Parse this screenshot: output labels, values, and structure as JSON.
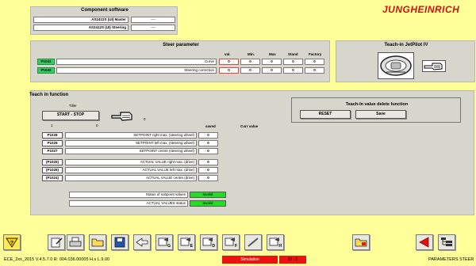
{
  "brand": "JUNGHEINRICH",
  "component_software": {
    "title": "Component software",
    "rows": [
      {
        "name": "AS2412S (UI) Master",
        "value": "----"
      },
      {
        "name": "AS2412S (UI) Steering",
        "value": "----"
      }
    ]
  },
  "steer_parameter": {
    "title": "Steer parameter",
    "headers": {
      "val": "val.",
      "min": "Min.",
      "max": "Max",
      "stand": "Stand",
      "factory": "Factory"
    },
    "rows": [
      {
        "code": "P1041",
        "name": "Curve",
        "val": "0",
        "min": "0",
        "max": "0",
        "stand": "0",
        "factory": "0"
      },
      {
        "code": "P1043",
        "name": "Steering correction",
        "val": "0",
        "min": "0",
        "max": "0",
        "stand": "0",
        "factory": "0"
      }
    ]
  },
  "teach_jetpilot": {
    "title": "Teach-in JetPilot IV"
  },
  "teach_function": {
    "title": "Teach in function",
    "tiller_label": "Tiller",
    "start_stop_label": "START - STOP",
    "start_stop_value": "0",
    "one_label": "1",
    "zero_label": "0",
    "col_saved": "saved",
    "col_curr": "Curr value",
    "setpoints": [
      {
        "code": "P1028",
        "name": "SETPOINT right max. (steering wheel)",
        "value": "0"
      },
      {
        "code": "P1029",
        "name": "SETPOINT left max. (steering wheel)",
        "value": "0"
      },
      {
        "code": "P1027",
        "name": "SETPOINT centre (steering wheel)",
        "value": "0"
      }
    ],
    "actuals": [
      {
        "code": "(P1025)",
        "name": "ACTUAL VALUE right max. (drive)",
        "value": "0"
      },
      {
        "code": "(P1026)",
        "name": "ACTUAL VALUE left max. (drive)",
        "value": "0"
      },
      {
        "code": "(P1024)",
        "name": "ACTUAL VALUE centre (drive)",
        "value": "0"
      }
    ],
    "status_rows": [
      {
        "label": "Status of subpoint values",
        "value": "invalid"
      },
      {
        "label": "ACTUAL VALUES status",
        "value": "invalid"
      }
    ]
  },
  "delete_function": {
    "title": "Teach-In value delete function",
    "reset_label": "RESET",
    "save_label": "Save"
  },
  "toolbar": {
    "icons": [
      "help-icon",
      "edit-icon",
      "print-icon",
      "folder-icon",
      "save-disk-icon",
      "transfer-icon",
      "icon-g",
      "icon-e",
      "icon-d",
      "icon-f",
      "pen-icon",
      "icon-h",
      "open-folder-icon",
      "back-arrow-icon",
      "tree-icon"
    ],
    "letters": {
      "g": "G",
      "e": "E",
      "d": "D",
      "f": "F",
      "h": "H"
    }
  },
  "statusbar": {
    "version": "ECE_2xx_2015  V.4.5.7.0  R: 004.036.00005  H.x  L.9.00",
    "simulation": "Simulation",
    "id": "ID : 0",
    "screen": "PARAMETERS STEER"
  },
  "colors": {
    "background": "#ffff99",
    "panel": "#d6d6cc",
    "green": "#22dd22",
    "brand_red": "#cc1111"
  }
}
